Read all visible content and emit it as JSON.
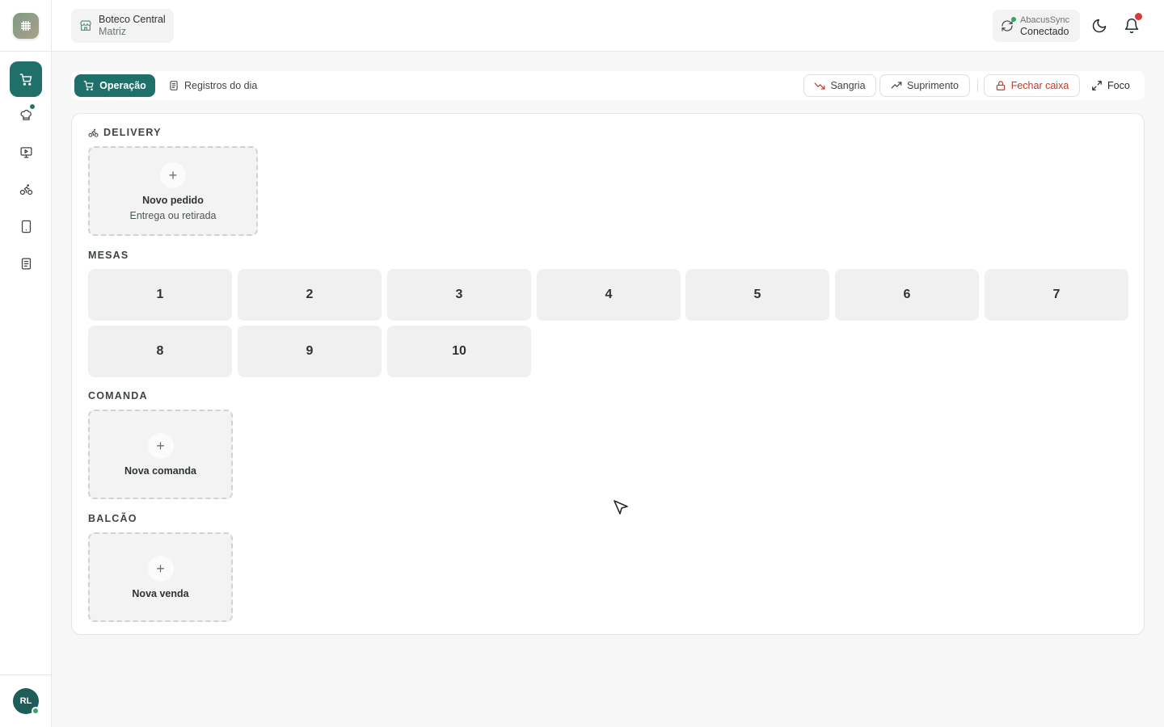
{
  "sidebar": {
    "items": [
      {
        "name": "operacao",
        "icon": "cart-icon",
        "active": true
      },
      {
        "name": "cozinha",
        "icon": "chef-hat-icon",
        "badge": true
      },
      {
        "name": "monitor",
        "icon": "monitor-play-icon"
      },
      {
        "name": "delivery",
        "icon": "bike-icon"
      },
      {
        "name": "tablet",
        "icon": "tablet-icon"
      },
      {
        "name": "relatorios",
        "icon": "document-icon"
      }
    ],
    "avatar_initials": "RL"
  },
  "header": {
    "store_name": "Boteco Central",
    "store_branch": "Matriz",
    "sync_title": "AbacusSync",
    "sync_status": "Conectado"
  },
  "toolbar": {
    "tab_operacao": "Operação",
    "tab_registros": "Registros do dia",
    "sangria": "Sangria",
    "suprimento": "Suprimento",
    "fechar_caixa": "Fechar caixa",
    "foco": "Foco"
  },
  "sections": {
    "delivery": {
      "label": "DELIVERY",
      "card_title": "Novo pedido",
      "card_sub": "Entrega ou retirada"
    },
    "mesas": {
      "label": "MESAS",
      "tables": [
        "1",
        "2",
        "3",
        "4",
        "5",
        "6",
        "7",
        "8",
        "9",
        "10"
      ]
    },
    "comanda": {
      "label": "COMANDA",
      "card_title": "Nova comanda"
    },
    "balcao": {
      "label": "BALCÃO",
      "card_title": "Nova venda"
    }
  },
  "colors": {
    "primary": "#1f6f6a",
    "danger": "#c0392b",
    "online": "#2ea866",
    "notification": "#d53b3b"
  }
}
